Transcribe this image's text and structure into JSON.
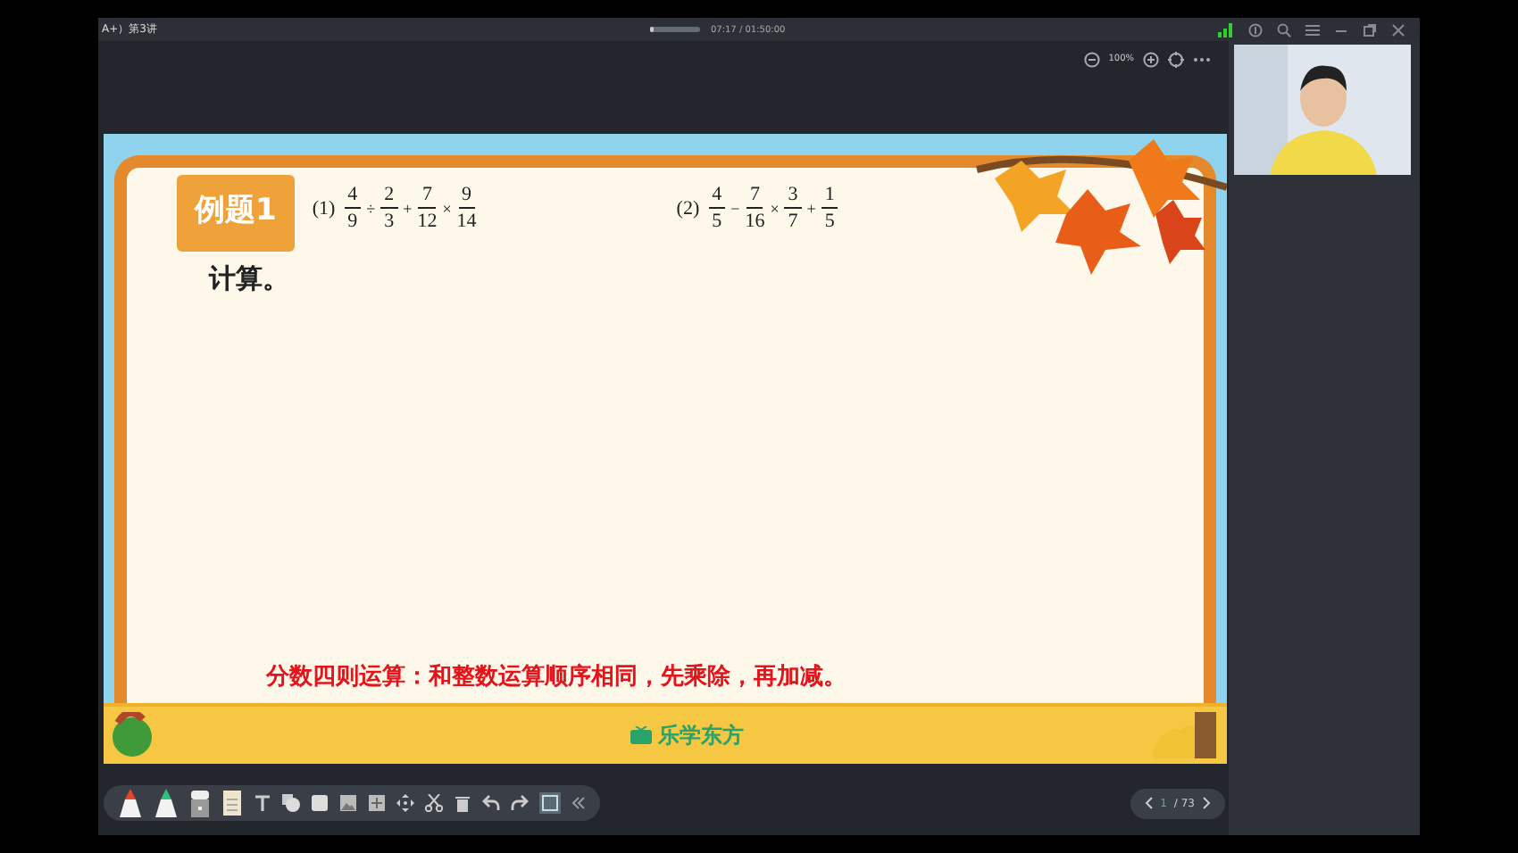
{
  "window": {
    "title": "A+）第3讲",
    "playback_time": "07:17 / 01:50:00",
    "progress": {
      "level": 0.07
    }
  },
  "zoom": {
    "value": "100%"
  },
  "slide": {
    "tag": "例题1",
    "instruction": "计算。",
    "problems": [
      {
        "label": "(1)",
        "terms": [
          {
            "kind": "fraction",
            "num": "4",
            "den": "9"
          },
          {
            "kind": "op",
            "text": "÷"
          },
          {
            "kind": "fraction",
            "num": "2",
            "den": "3"
          },
          {
            "kind": "op",
            "text": "+"
          },
          {
            "kind": "fraction",
            "num": "7",
            "den": "12"
          },
          {
            "kind": "op",
            "text": "×"
          },
          {
            "kind": "fraction",
            "num": "9",
            "den": "14"
          }
        ]
      },
      {
        "label": "(2)",
        "terms": [
          {
            "kind": "fraction",
            "num": "4",
            "den": "5"
          },
          {
            "kind": "op",
            "text": "−"
          },
          {
            "kind": "fraction",
            "num": "7",
            "den": "16"
          },
          {
            "kind": "op",
            "text": "×"
          },
          {
            "kind": "fraction",
            "num": "3",
            "den": "7"
          },
          {
            "kind": "op",
            "text": "+"
          },
          {
            "kind": "fraction",
            "num": "1",
            "den": "5"
          }
        ]
      }
    ],
    "note": "分数四则运算：和整数运算顺序相同，先乘除，再加减。",
    "logo": "乐学东方"
  },
  "pager": {
    "current": "1",
    "total": "/ 73"
  }
}
